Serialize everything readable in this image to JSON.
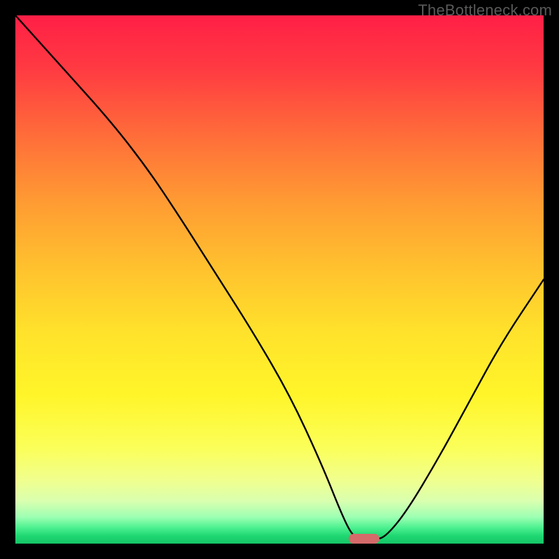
{
  "watermark": "TheBottleneck.com",
  "brand_colors": {
    "background": "#000000",
    "marker": "#d46a6a",
    "curve": "#000000"
  },
  "chart_data": {
    "type": "line",
    "title": "",
    "xlabel": "",
    "ylabel": "",
    "xlim": [
      0,
      100
    ],
    "ylim": [
      0,
      100
    ],
    "marker_x": 66,
    "curve_points": [
      {
        "x": 0,
        "y": 100
      },
      {
        "x": 9,
        "y": 90
      },
      {
        "x": 18,
        "y": 80
      },
      {
        "x": 25,
        "y": 71
      },
      {
        "x": 31,
        "y": 62
      },
      {
        "x": 38,
        "y": 51
      },
      {
        "x": 45,
        "y": 40
      },
      {
        "x": 52,
        "y": 28
      },
      {
        "x": 58,
        "y": 15
      },
      {
        "x": 62,
        "y": 5
      },
      {
        "x": 64,
        "y": 1.2
      },
      {
        "x": 66,
        "y": 0.8
      },
      {
        "x": 68,
        "y": 0.8
      },
      {
        "x": 70,
        "y": 1.2
      },
      {
        "x": 74,
        "y": 6
      },
      {
        "x": 80,
        "y": 16
      },
      {
        "x": 86,
        "y": 27
      },
      {
        "x": 92,
        "y": 38
      },
      {
        "x": 100,
        "y": 50
      }
    ]
  }
}
